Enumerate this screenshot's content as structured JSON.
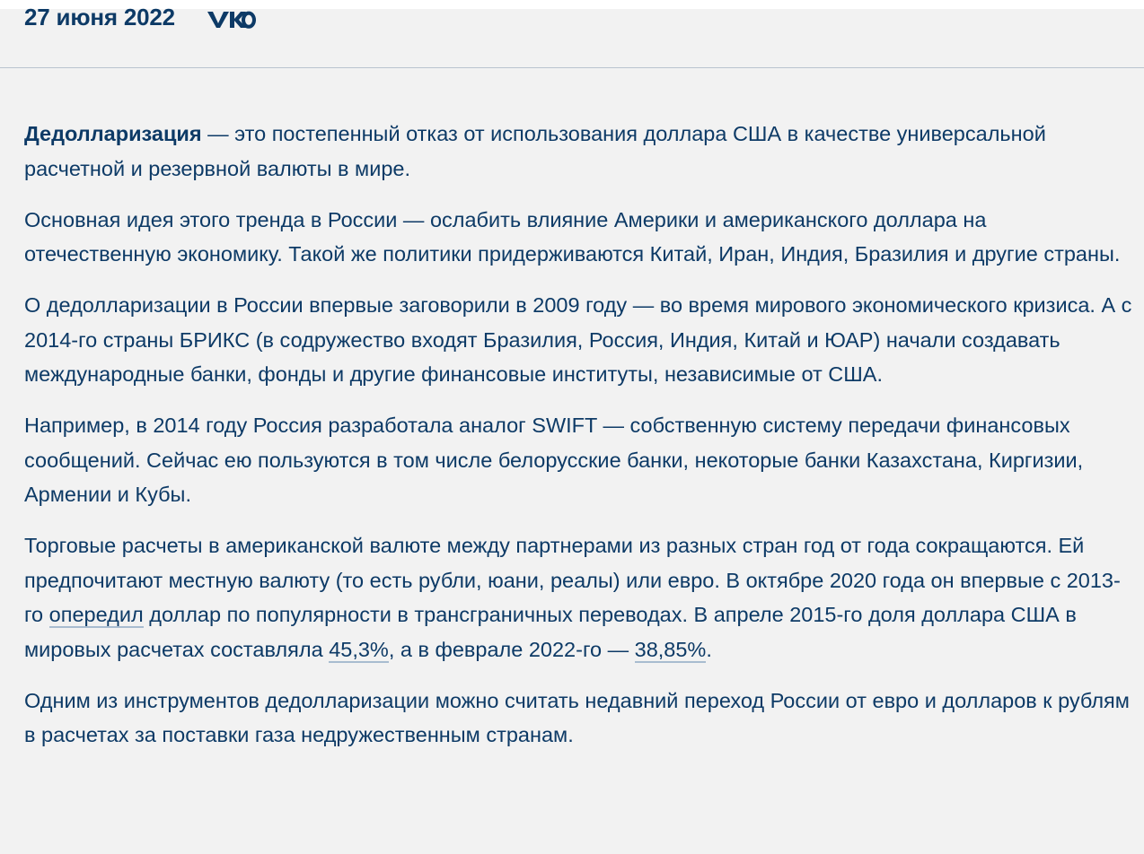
{
  "meta": {
    "date": "27 июня 2022",
    "share_icon": "vk-icon"
  },
  "article": {
    "p1": {
      "term": "Дедолларизация",
      "rest": " — это постепенный отказ от использования доллара США в качестве универсальной расчетной и резервной валюты в мире."
    },
    "p2": "Основная идея этого тренда в России — ослабить влияние Америки и американского доллара на отечественную экономику. Такой же политики придерживаются Китай, Иран, Индия, Бразилия и другие страны.",
    "p3": "О дедолларизации в России впервые заговорили в 2009 году — во время мирового экономического кризиса. А с 2014-го страны БРИКС (в содружество входят Бразилия, Россия, Индия, Китай и ЮАР) начали создавать международные банки, фонды и другие финансовые институты, независимые от США.",
    "p4": "Например, в 2014 году Россия разработала аналог SWIFT — собственную систему передачи финансовых сообщений. Сейчас ею пользуются в том числе белорусские банки, некоторые банки Казахстана, Киргизии, Армении и Кубы.",
    "p5": {
      "t1": "Торговые расчеты в американской валюте между партнерами из разных стран год от года сокращаются. Ей предпочитают местную валюту (то есть рубли, юани, реалы) или евро. В октябре 2020 года он впервые с 2013-го ",
      "link1": "опередил",
      "t2": " доллар по популярности в трансграничных переводах. В апреле 2015-го доля доллара США в мировых расчетах составляла ",
      "link2": "45,3%",
      "t3": ", а в феврале 2022-го — ",
      "link3": "38,85%",
      "t4": "."
    },
    "p6": "Одним из инструментов дедолларизации можно считать недавний переход России от евро и долларов к рублям в расчетах за поставки газа недружественным странам."
  },
  "colors": {
    "text": "#0d3a66",
    "background": "#f2f2f2",
    "divider": "#b9c3cf",
    "link_underline": "#a8bcd0"
  }
}
